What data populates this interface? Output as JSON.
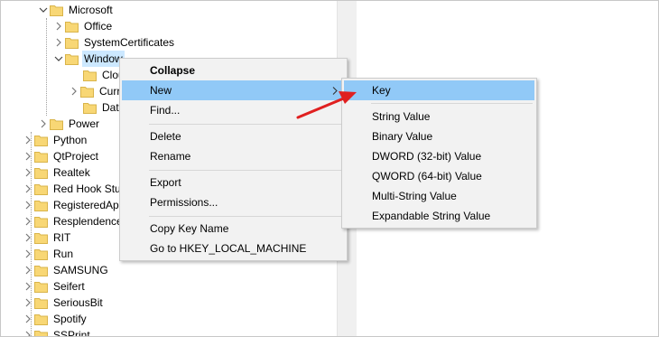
{
  "tree": {
    "nodes": [
      {
        "label": "Microsoft",
        "expanded": true
      },
      {
        "label": "Office",
        "expanded": false
      },
      {
        "label": "SystemCertificates",
        "expanded": false
      },
      {
        "label": "Window",
        "expanded": true,
        "selected": true
      },
      {
        "label": "Clou"
      },
      {
        "label": "Curr"
      },
      {
        "label": "Data"
      },
      {
        "label": "Power"
      },
      {
        "label": "Python"
      },
      {
        "label": "QtProject"
      },
      {
        "label": "Realtek"
      },
      {
        "label": "Red Hook Stu"
      },
      {
        "label": "RegisteredAp"
      },
      {
        "label": "Resplendence"
      },
      {
        "label": "RIT"
      },
      {
        "label": "Run"
      },
      {
        "label": "SAMSUNG"
      },
      {
        "label": "Seifert"
      },
      {
        "label": "SeriousBit"
      },
      {
        "label": "Spotify"
      },
      {
        "label": "SSPrint"
      }
    ]
  },
  "context_menu": {
    "items": [
      {
        "label": "Collapse"
      },
      {
        "label": "New"
      },
      {
        "label": "Find..."
      },
      {
        "label": "Delete"
      },
      {
        "label": "Rename"
      },
      {
        "label": "Export"
      },
      {
        "label": "Permissions..."
      },
      {
        "label": "Copy Key Name"
      },
      {
        "label": "Go to HKEY_LOCAL_MACHINE"
      }
    ],
    "highlighted": "New"
  },
  "submenu": {
    "items": [
      {
        "label": "Key"
      },
      {
        "label": "String Value"
      },
      {
        "label": "Binary Value"
      },
      {
        "label": "DWORD (32-bit) Value"
      },
      {
        "label": "QWORD (64-bit) Value"
      },
      {
        "label": "Multi-String Value"
      },
      {
        "label": "Expandable String Value"
      }
    ],
    "highlighted": "Key"
  },
  "colors": {
    "highlight": "#91c9f7",
    "selection": "#cce8ff",
    "folder": "#f8d775",
    "annotation_arrow": "#e02020"
  },
  "icons": {
    "folder": "folder-icon",
    "expand": "chevron-right-icon",
    "collapse": "chevron-down-icon",
    "submenu": "submenu-arrow-icon"
  }
}
